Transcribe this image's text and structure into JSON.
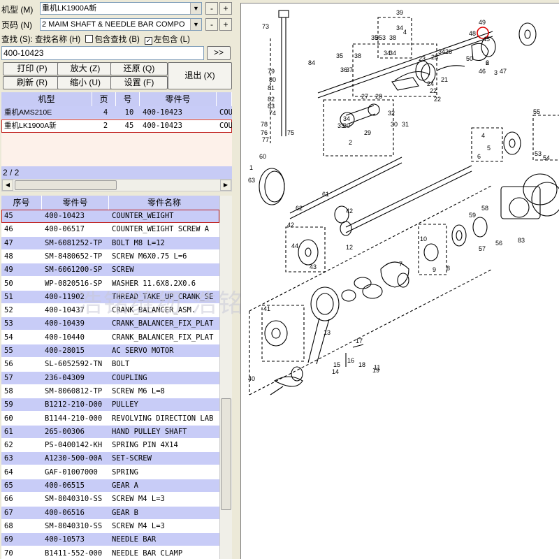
{
  "form": {
    "model_label": "机型 (M)",
    "model_value": "重机LK1900A新",
    "page_label": "页码 (N)",
    "page_value": "2 MAIM SHAFT & NEEDLE BAR COMPO",
    "search_label": "查找 (S):",
    "search_name_label": "查找名称 (H)",
    "include_label": "包含查找 (B)",
    "left_include_label": "左包含 (L)",
    "search_value": "400-10423",
    "go_label": ">>",
    "minus": "-",
    "plus": "+",
    "check_mark": "✓"
  },
  "buttons": {
    "print": "打印 (P)",
    "zoom_in": "放大 (Z)",
    "restore": "还原 (Q)",
    "refresh": "刷新 (R)",
    "zoom_out": "缩小 (U)",
    "settings": "设置 (F)",
    "exit": "退出 (X)"
  },
  "top_table": {
    "headers": [
      "机型",
      "页",
      "号",
      "零件号"
    ],
    "rows": [
      {
        "model": "重机AMS210E",
        "page": "4",
        "no": "10",
        "part": "400-10423",
        "extra": "COU"
      },
      {
        "model": "重机LK1900A新",
        "page": "2",
        "no": "45",
        "part": "400-10423",
        "extra": "COU"
      }
    ],
    "pager": "2 / 2"
  },
  "parts_table": {
    "headers": [
      "序号",
      "零件号",
      "零件名称"
    ],
    "rows": [
      {
        "no": "45",
        "part": "400-10423",
        "name": "COUNTER_WEIGHT"
      },
      {
        "no": "46",
        "part": "400-06517",
        "name": "COUNTER_WEIGHT SCREW A"
      },
      {
        "no": "47",
        "part": "SM-6081252-TP",
        "name": "BOLT M8 L=12"
      },
      {
        "no": "48",
        "part": "SM-8480652-TP",
        "name": "SCREW M6X0.75 L=6"
      },
      {
        "no": "49",
        "part": "SM-6061200-SP",
        "name": "SCREW"
      },
      {
        "no": "50",
        "part": "WP-0820516-SP",
        "name": "WASHER 11.6X8.2X0.6"
      },
      {
        "no": "51",
        "part": "400-11902",
        "name": "THREAD_TAKE_UP_CRANK_SE"
      },
      {
        "no": "52",
        "part": "400-10437",
        "name": "CRANK_BALANCER_ASM."
      },
      {
        "no": "53",
        "part": "400-10439",
        "name": "CRANK_BALANCER_FIX_PLAT"
      },
      {
        "no": "54",
        "part": "400-10440",
        "name": "CRANK_BALANCER_FIX_PLAT"
      },
      {
        "no": "55",
        "part": "400-28015",
        "name": "AC SERVO MOTOR"
      },
      {
        "no": "56",
        "part": "SL-6052592-TN",
        "name": "BOLT"
      },
      {
        "no": "57",
        "part": "236-04309",
        "name": "COUPLING"
      },
      {
        "no": "58",
        "part": "SM-8060812-TP",
        "name": "SCREW M6 L=8"
      },
      {
        "no": "59",
        "part": "B1212-210-D00",
        "name": "PULLEY"
      },
      {
        "no": "60",
        "part": "B1144-210-000",
        "name": "REVOLVING DIRECTION LAB"
      },
      {
        "no": "61",
        "part": "265-00306",
        "name": "HAND PULLEY SHAFT"
      },
      {
        "no": "62",
        "part": "PS-0400142-KH",
        "name": "SPRING PIN 4X14"
      },
      {
        "no": "63",
        "part": "A1230-500-00A",
        "name": "SET-SCREW"
      },
      {
        "no": "64",
        "part": "GAF-01007000",
        "name": "SPRING"
      },
      {
        "no": "65",
        "part": "400-06515",
        "name": "GEAR A"
      },
      {
        "no": "66",
        "part": "SM-8040310-SS",
        "name": "SCREW M4 L=3"
      },
      {
        "no": "67",
        "part": "400-06516",
        "name": "GEAR B"
      },
      {
        "no": "68",
        "part": "SM-8040310-SS",
        "name": "SCREW M4 L=3"
      },
      {
        "no": "69",
        "part": "400-10573",
        "name": "NEEDLE BAR"
      },
      {
        "no": "70",
        "part": "B1411-552-000",
        "name": "NEEDLE BAR CLAMP"
      }
    ]
  },
  "watermark": "浩铭缝纫 浩铭缝配",
  "diagram": {
    "labels": [
      "73",
      "84",
      "35",
      "38",
      "36",
      "37",
      "35",
      "39",
      "34",
      "4",
      "3",
      "35",
      "38",
      "34",
      "34",
      "26",
      "34",
      "25",
      "23",
      "24",
      "22",
      "21",
      "22",
      "27",
      "28",
      "29",
      "20",
      "2",
      "33",
      "34",
      "32",
      "30",
      "31",
      "76",
      "77",
      "78",
      "75",
      "74",
      "79",
      "80",
      "81",
      "82",
      "83",
      "1",
      "49",
      "48",
      "50",
      "46",
      "47",
      "45",
      "2",
      "3",
      "4",
      "5",
      "6",
      "55",
      "54",
      "53",
      "60",
      "63",
      "62",
      "61",
      "42",
      "12",
      "44",
      "43",
      "42",
      "58",
      "57",
      "56",
      "59",
      "83",
      "10",
      "8",
      "9",
      "7",
      "13",
      "14",
      "15",
      "16",
      "17",
      "18",
      "19",
      "11",
      "40",
      "41",
      "6"
    ]
  }
}
